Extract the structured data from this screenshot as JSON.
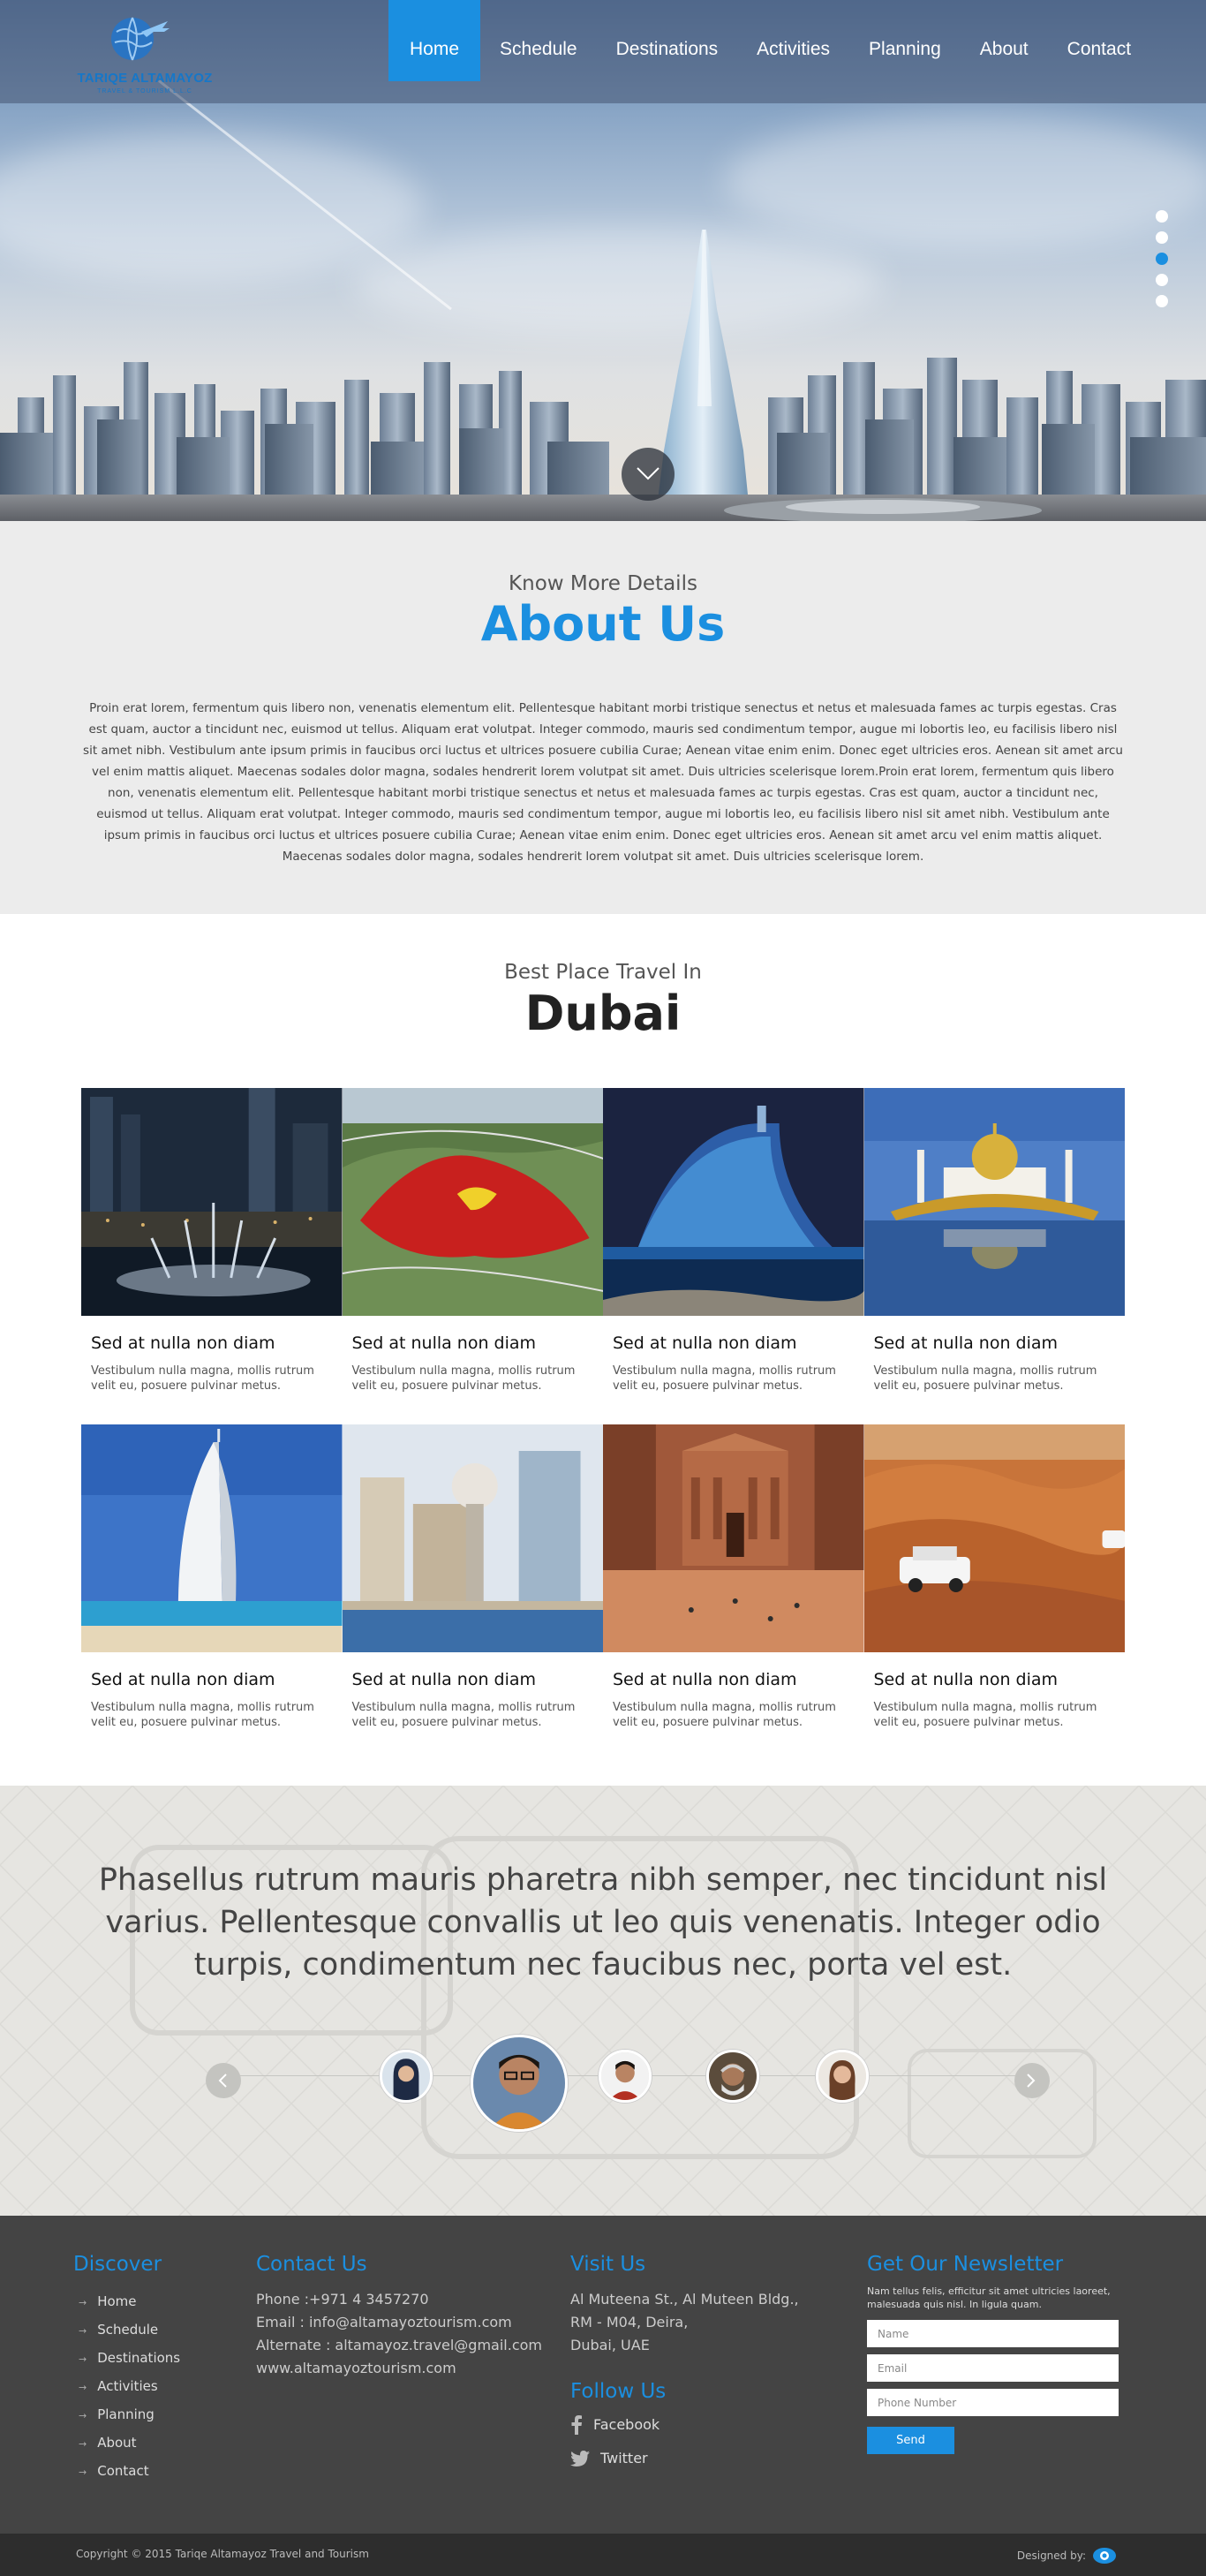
{
  "logo": {
    "name": "TARIQE ALTAMAYOZ",
    "sub": "TRAVEL & TOURISM L.L.C"
  },
  "nav": {
    "items": [
      {
        "label": "Home",
        "active": true
      },
      {
        "label": "Schedule"
      },
      {
        "label": "Destinations"
      },
      {
        "label": "Activities"
      },
      {
        "label": "Planning"
      },
      {
        "label": "About"
      },
      {
        "label": "Contact"
      }
    ]
  },
  "slider": {
    "dots": 5,
    "active_index": 2
  },
  "about": {
    "kicker": "Know More Details",
    "title": "About Us",
    "body": "Proin erat lorem, fermentum quis libero non, venenatis elementum elit. Pellentesque habitant morbi tristique senectus et netus et malesuada fames ac turpis egestas. Cras est quam, auctor a tincidunt nec, euismod ut tellus. Aliquam erat volutpat. Integer commodo, mauris sed condimentum tempor, augue mi lobortis leo, eu facilisis libero nisl sit amet nibh. Vestibulum ante ipsum primis in faucibus orci luctus et ultrices posuere cubilia Curae; Aenean vitae enim enim. Donec eget ultricies eros. Aenean sit amet arcu vel enim mattis aliquet. Maecenas sodales dolor magna, sodales hendrerit lorem volutpat sit amet. Duis ultricies scelerisque lorem.Proin erat lorem, fermentum quis libero non, venenatis elementum elit. Pellentesque habitant morbi tristique senectus et netus et malesuada fames ac turpis egestas. Cras est quam, auctor a tincidunt nec, euismod ut tellus. Aliquam erat volutpat. Integer commodo, mauris sed condimentum tempor, augue mi lobortis leo, eu facilisis libero nisl sit amet nibh. Vestibulum ante ipsum primis in faucibus orci luctus et ultrices posuere cubilia Curae; Aenean vitae enim enim. Donec eget ultricies eros. Aenean sit amet arcu vel enim mattis aliquet. Maecenas sodales dolor magna, sodales hendrerit lorem volutpat sit amet. Duis ultricies scelerisque lorem."
  },
  "dubai": {
    "kicker": "Best Place Travel In",
    "title": "Dubai",
    "cards": [
      {
        "title": "Sed at nulla non diam",
        "desc": "Vestibulum nulla magna, mollis rutrum velit eu, posuere pulvinar metus.",
        "image": "fountain-night"
      },
      {
        "title": "Sed at nulla non diam",
        "desc": "Vestibulum nulla magna, mollis rutrum velit eu, posuere pulvinar metus.",
        "image": "ferrari-world"
      },
      {
        "title": "Sed at nulla non diam",
        "desc": "Vestibulum nulla magna, mollis rutrum velit eu, posuere pulvinar metus.",
        "image": "jumeirah-hotel"
      },
      {
        "title": "Sed at nulla non diam",
        "desc": "Vestibulum nulla magna, mollis rutrum velit eu, posuere pulvinar metus.",
        "image": "golden-mosque"
      },
      {
        "title": "Sed at nulla non diam",
        "desc": "Vestibulum nulla magna, mollis rutrum velit eu, posuere pulvinar metus.",
        "image": "burj-al-arab"
      },
      {
        "title": "Sed at nulla non diam",
        "desc": "Vestibulum nulla magna, mollis rutrum velit eu, posuere pulvinar metus.",
        "image": "etisalat-towers"
      },
      {
        "title": "Sed at nulla non diam",
        "desc": "Vestibulum nulla magna, mollis rutrum velit eu, posuere pulvinar metus.",
        "image": "petra-treasury"
      },
      {
        "title": "Sed at nulla non diam",
        "desc": "Vestibulum nulla magna, mollis rutrum velit eu, posuere pulvinar metus.",
        "image": "desert-safari"
      }
    ]
  },
  "testimonial": {
    "quote": "Phasellus rutrum mauris pharetra nibh semper, nec tincidunt nisl varius. Pellentesque convallis ut leo quis venenatis. Integer odio turpis, condimentum nec faucibus nec, porta vel est.",
    "avatars": [
      "woman-hijab",
      "man-glasses",
      "man-smiling",
      "older-man",
      "woman-smiling"
    ],
    "active_avatar": 1
  },
  "footer": {
    "discover": {
      "heading": "Discover",
      "items": [
        "Home",
        "Schedule",
        "Destinations",
        "Activities",
        "Planning",
        "About",
        "Contact"
      ]
    },
    "contact": {
      "heading": "Contact Us",
      "lines": [
        "Phone :+971 4 3457270",
        "Email : info@altamayoztourism.com",
        "Alternate : altamayoz.travel@gmail.com",
        "www.altamayoztourism.com"
      ]
    },
    "visit": {
      "heading": "Visit Us",
      "lines": [
        "Al Muteena St., Al Muteen Bldg.,",
        "RM - M04, Deira,",
        "Dubai, UAE"
      ]
    },
    "follow": {
      "heading": "Follow Us",
      "facebook": "Facebook",
      "twitter": "Twitter"
    },
    "newsletter": {
      "heading": "Get Our Newsletter",
      "desc": "Nam tellus felis, efficitur sit amet ultricies laoreet, malesuada quis nisl. In ligula quam.",
      "name_placeholder": "Name",
      "email_placeholder": "Email",
      "phone_placeholder": "Phone Number",
      "send": "Send"
    }
  },
  "bottom": {
    "copyright": "Copyright © 2015 Tariqe Altamayoz Travel and Tourism",
    "designed_by": "Designed by:"
  },
  "colors": {
    "accent": "#1b8fe0",
    "footer_bg": "#444444",
    "bottom_bg": "#2d2d2d"
  }
}
